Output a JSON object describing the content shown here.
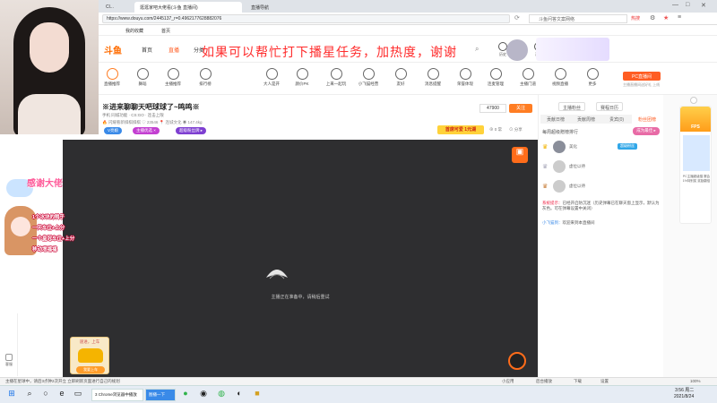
{
  "browser": {
    "tabs": [
      {
        "label": "Cl...",
        "active": false
      },
      {
        "label": "逛逛家吧大佬看(斗鱼 直播间)",
        "active": true
      },
      {
        "label": "直播导航",
        "active": false
      }
    ],
    "url": "https://www.douyu.com/2445137_r=0.4962177628882076",
    "search_placeholder": "斗鱼问答文案网络",
    "search_tag": "热搜",
    "bookmarks": [
      "我的收藏",
      "首页"
    ]
  },
  "site": {
    "logo": "斗鱼",
    "nav": [
      "首页",
      "直播",
      "分类"
    ],
    "overlay_banner": "如果可以帮忙打下播星任务，加热度，谢谢",
    "header_icons": [
      "历史",
      "关注",
      "消息",
      "等级",
      "位置"
    ],
    "categories": [
      {
        "label": "直播推荐"
      },
      {
        "label": "舞蹈"
      },
      {
        "label": "主播推荐"
      },
      {
        "label": "排行榜"
      },
      {
        "label": "大人是开"
      },
      {
        "label": "颜价PK"
      },
      {
        "label": "上来一起玩"
      },
      {
        "label": "小飞猫经营"
      },
      {
        "label": "友好"
      },
      {
        "label": "消息提醒"
      },
      {
        "label": "荣誉体现"
      },
      {
        "label": "连麦管理"
      },
      {
        "label": "主播门道"
      },
      {
        "label": "视频直播"
      },
      {
        "label": "更多"
      }
    ],
    "pc_button": "PC直播间",
    "pc_sub": "主播直播间送好礼 上线"
  },
  "room": {
    "title": "※进来聊聊天吧球球了~鸣鸣※",
    "meta": "手机    同城功能 · CS:GO · 连击上限",
    "stats": "🔥 闪耀看新棋棋棋棋    ♡ 23546    📍 连城文化    ◉ 147.4kg",
    "follow_count": "47900",
    "follow_label": "关注",
    "tags": [
      "V亮娘",
      "主播优选 ×",
      "超级粉丝牌 ▸"
    ],
    "hot_badge": "首席可爱 1元湖",
    "meta_right": [
      "⊕ 0 常",
      "⊙ 分享"
    ]
  },
  "player": {
    "message": "主播正在准备中，请稍后重试"
  },
  "overlay": {
    "thanks": "感谢大佬",
    "gift_lines": [
      "1个冰块的鸭子",
      "一天车位+上分",
      "一个皇冠车位+上分",
      "移动增福福"
    ],
    "car_title": "速进，上车",
    "car_button": "我要上车"
  },
  "side_panel": {
    "buttons": [
      "主播粉丝",
      "赛程日历"
    ],
    "rank_tabs": [
      "贡献日榜",
      "贡献周榜",
      "贵宾(0)",
      "粉丝团榜"
    ],
    "weekly_label": "每周超级赠榜排行",
    "weekly_button": "成为最佳 ▸",
    "rank": [
      {
        "crown": "♛",
        "name": "美化",
        "badge": "超级粉丝"
      },
      {
        "crown": "♛",
        "name": "虚位以待",
        "badge": ""
      },
      {
        "crown": "♛",
        "name": "虚位以待",
        "badge": ""
      }
    ],
    "chat": [
      {
        "prefix": "系统提示：",
        "text": "已经开启防沉迷（历史弹幕已在聊天窗上显示，默认为灰色。可在弹幕设置中关闭）"
      },
      {
        "prefix": "小飞猫到：",
        "text": "欢迎来到本直播间"
      }
    ]
  },
  "promo": {
    "top": "FPS",
    "text": "PC主播超级猫 赛会1%特别奖 奖励翻倍"
  },
  "left_strip": [
    "游戏",
    "交流",
    "客服"
  ],
  "status_bar": {
    "left": "主播在星球中，请后3点钟2次开立 立即刷新页面进行自己的规划",
    "right": [
      "小应用",
      "后台播放",
      "下载",
      "设置"
    ],
    "zoom": "100%"
  },
  "taskbar": {
    "apps": [
      "3 Chrome浏览器中播放",
      "图播一下"
    ],
    "clock_time": "3:56 周二",
    "clock_date": "2021/8/24"
  }
}
